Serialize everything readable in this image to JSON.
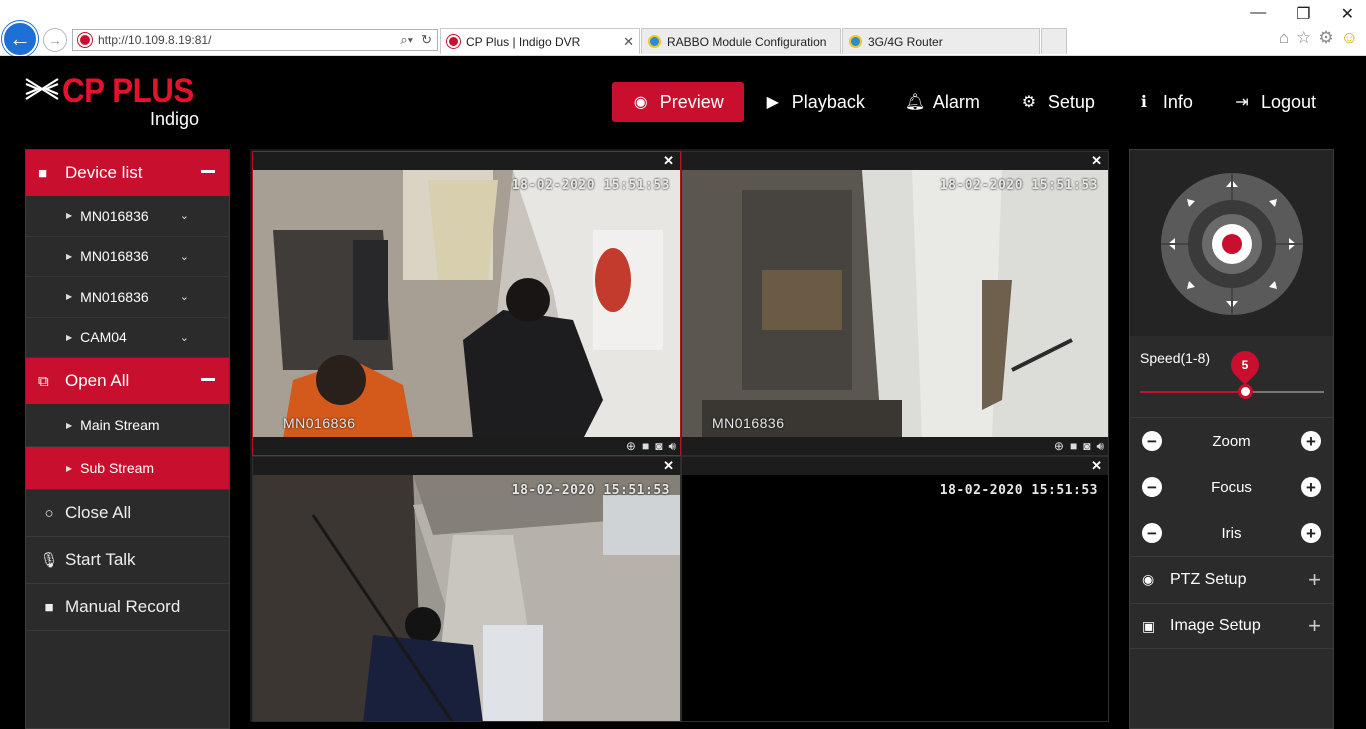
{
  "browser": {
    "url": "http://10.109.8.19:81/",
    "tabs": [
      {
        "label": "CP Plus | Indigo DVR",
        "active": true
      },
      {
        "label": "RABBO Module Configuration",
        "active": false
      },
      {
        "label": "3G/4G Router",
        "active": false
      }
    ],
    "window_controls": [
      "—",
      "❐",
      "✕"
    ]
  },
  "app": {
    "brand": "CP PLUS",
    "brand_sub": "Indigo",
    "accent_color": "#c8102e",
    "nav": [
      {
        "label": "Preview",
        "icon": "eye-icon",
        "active": true
      },
      {
        "label": "Playback",
        "icon": "play-icon",
        "active": false
      },
      {
        "label": "Alarm",
        "icon": "bell-icon",
        "active": false
      },
      {
        "label": "Setup",
        "icon": "gear-icon",
        "active": false
      },
      {
        "label": "Info",
        "icon": "info-icon",
        "active": false
      },
      {
        "label": "Logout",
        "icon": "logout-icon",
        "active": false
      }
    ]
  },
  "leftpanel": {
    "device_list_label": "Device list",
    "devices": [
      "MN016836",
      "MN016836",
      "MN016836",
      "CAM04"
    ],
    "open_all_label": "Open All",
    "streams": [
      {
        "label": "Main Stream",
        "selected": false
      },
      {
        "label": "Sub Stream",
        "selected": true
      }
    ],
    "actions": [
      {
        "label": "Close All",
        "icon": "circle-icon"
      },
      {
        "label": "Start Talk",
        "icon": "microphone-icon"
      },
      {
        "label": "Manual Record",
        "icon": "video-camera-icon"
      }
    ]
  },
  "grid": {
    "cells": [
      {
        "timestamp": "18-02-2020 15:51:53",
        "camera": "MN016836",
        "selected": true
      },
      {
        "timestamp": "18-02-2020 15:51:53",
        "camera": "MN016836",
        "selected": false
      },
      {
        "timestamp": "18-02-2020 15:51:53",
        "camera": "",
        "selected": false
      },
      {
        "timestamp": "18-02-2020 15:51:53",
        "camera": "",
        "selected": false
      }
    ]
  },
  "rightpanel": {
    "speed_label": "Speed(1-8)",
    "speed_value": "5",
    "speed_min": 1,
    "speed_max": 8,
    "controls": [
      {
        "label": "Zoom"
      },
      {
        "label": "Focus"
      },
      {
        "label": "Iris"
      }
    ],
    "setup": [
      {
        "label": "PTZ Setup",
        "icon": "gamepad-icon"
      },
      {
        "label": "Image Setup",
        "icon": "image-icon"
      }
    ]
  }
}
